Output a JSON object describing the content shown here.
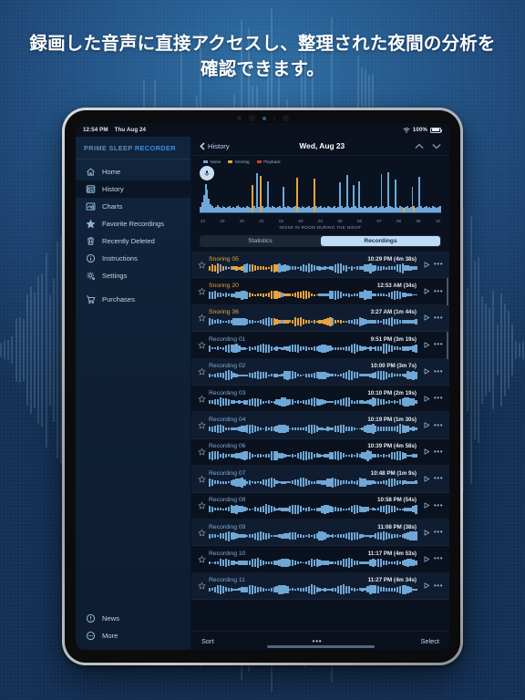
{
  "headline": "録画した音声に直接アクセスし、整理された夜間の分析を確認できます。",
  "statusbar": {
    "time": "12:54 PM",
    "date": "Thu Aug 24",
    "battery_percent": "100%",
    "wifi_icon": "wifi-icon",
    "battery_icon": "battery-icon"
  },
  "sidebar": {
    "app_title_part1": "PRIME SLEEP ",
    "app_title_part2": "RECORDER",
    "items": [
      {
        "label": "Home",
        "icon": "home-icon",
        "active": false
      },
      {
        "label": "History",
        "icon": "history-icon",
        "active": true
      },
      {
        "label": "Charts",
        "icon": "charts-icon",
        "active": false
      },
      {
        "label": "Favorite Recordings",
        "icon": "star-icon",
        "active": false
      },
      {
        "label": "Recently Deleted",
        "icon": "trash-icon",
        "active": false
      },
      {
        "label": "Instructions",
        "icon": "info-icon",
        "active": false
      },
      {
        "label": "Settings",
        "icon": "gear-icon",
        "active": false
      }
    ],
    "purchases": {
      "label": "Purchases",
      "icon": "cart-icon"
    },
    "footer_items": [
      {
        "label": "News",
        "icon": "news-icon"
      },
      {
        "label": "More",
        "icon": "more-icon"
      }
    ]
  },
  "header": {
    "back_label": "History",
    "title": "Wed, Aug 23",
    "prev_icon": "chevron-up-icon",
    "next_icon": "chevron-down-icon"
  },
  "chart_data": {
    "type": "bar",
    "title": "",
    "caption": "NOISE IN ROOM DURING THE NIGHT",
    "xlabel": "",
    "ylabel": "",
    "categories": [
      "22",
      "23",
      "00",
      "01",
      "02",
      "03",
      "04",
      "05",
      "06",
      "07",
      "08",
      "09",
      "10"
    ],
    "legend": [
      {
        "label": "Noise",
        "color": "#6fa8d6"
      },
      {
        "label": "Snoring",
        "color": "#e8a33d"
      },
      {
        "label": "Playback",
        "color": "#d93b2b"
      }
    ],
    "legend_position": "top-left",
    "grid": false,
    "ylim": [
      0,
      100
    ],
    "values": [
      12,
      22,
      38,
      64,
      52,
      30,
      18,
      14,
      10,
      12,
      16,
      12,
      10,
      14,
      12,
      10,
      12,
      14,
      10,
      12,
      10,
      14,
      16,
      12,
      10,
      12,
      10,
      14,
      12,
      10,
      62,
      14,
      10,
      88,
      12,
      82,
      14,
      10,
      12,
      70,
      12,
      10,
      14,
      12,
      10,
      12,
      14,
      10,
      58,
      12,
      10,
      14,
      12,
      10,
      12,
      14,
      78,
      12,
      10,
      14,
      12,
      10,
      12,
      14,
      10,
      12,
      76,
      14,
      10,
      12,
      14,
      10,
      12,
      10,
      14,
      12,
      10,
      12,
      14,
      10,
      12,
      68,
      14,
      10,
      12,
      84,
      14,
      10,
      12,
      62,
      14,
      10,
      70,
      12,
      10,
      14,
      12,
      10,
      12,
      14,
      10,
      12,
      14,
      10,
      12,
      86,
      14,
      10,
      12,
      90,
      14,
      12,
      10,
      74,
      12,
      10,
      14,
      12,
      10,
      12,
      14,
      10,
      12,
      58,
      14,
      10,
      12,
      80,
      14,
      10,
      12,
      14,
      10,
      12,
      10,
      14,
      12,
      10,
      12,
      14
    ],
    "snoring_indices": [
      30,
      35,
      56,
      66,
      118,
      124
    ]
  },
  "segmented": {
    "options": [
      "Statistics",
      "Recordings"
    ],
    "selected": "Recordings"
  },
  "recordings": [
    {
      "name": "Snoring 05",
      "time": "10:29 PM",
      "duration": "(4m 38s)",
      "snoring": true,
      "favorite": false
    },
    {
      "name": "Snoring 20",
      "time": "12:53 AM",
      "duration": "(34s)",
      "snoring": true,
      "favorite": false
    },
    {
      "name": "Snoring 36",
      "time": "3:27 AM",
      "duration": "(1m 44s)",
      "snoring": true,
      "favorite": false
    },
    {
      "name": "Recording 01",
      "time": "9:51 PM",
      "duration": "(3m 19s)",
      "snoring": false,
      "favorite": false
    },
    {
      "name": "Recording 02",
      "time": "10:00 PM",
      "duration": "(3m 7s)",
      "snoring": false,
      "favorite": false
    },
    {
      "name": "Recording 03",
      "time": "10:10 PM",
      "duration": "(2m 19s)",
      "snoring": false,
      "favorite": false
    },
    {
      "name": "Recording 04",
      "time": "10:19 PM",
      "duration": "(1m 30s)",
      "snoring": false,
      "favorite": false
    },
    {
      "name": "Recording 06",
      "time": "10:39 PM",
      "duration": "(4m 58s)",
      "snoring": false,
      "favorite": false
    },
    {
      "name": "Recording 07",
      "time": "10:48 PM",
      "duration": "(1m 9s)",
      "snoring": false,
      "favorite": false
    },
    {
      "name": "Recording 08",
      "time": "10:58 PM",
      "duration": "(54s)",
      "snoring": false,
      "favorite": false
    },
    {
      "name": "Recording 09",
      "time": "11:08 PM",
      "duration": "(38s)",
      "snoring": false,
      "favorite": false
    },
    {
      "name": "Recording 10",
      "time": "11:17 PM",
      "duration": "(4m 53s)",
      "snoring": false,
      "favorite": false
    },
    {
      "name": "Recording 11",
      "time": "11:27 PM",
      "duration": "(4m 34s)",
      "snoring": false,
      "favorite": false
    }
  ],
  "row_icons": {
    "star": "star-icon",
    "play": "play-icon",
    "menu": "ellipsis-icon"
  },
  "toolbar": {
    "sort_label": "Sort",
    "more_label": "•••",
    "select_label": "Select"
  },
  "colors": {
    "noise": "#6fa8d6",
    "snoring": "#e8a33d",
    "playback": "#d93b2b",
    "accent": "#3c8fe0",
    "segment_active_bg": "#bfdcf5",
    "background": "#1b4a72"
  }
}
